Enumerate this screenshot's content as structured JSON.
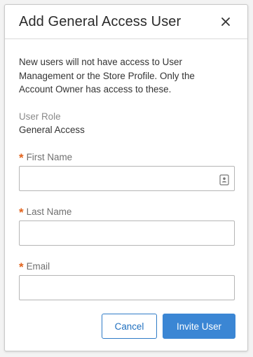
{
  "dialog": {
    "title": "Add General Access User",
    "description": "New users will not have access to User Management or the Store Profile. Only the Account Owner has access to these."
  },
  "user_role": {
    "label": "User Role",
    "value": "General Access"
  },
  "fields": {
    "required_marker": "*",
    "first_name": {
      "label": "First Name",
      "value": "",
      "placeholder": ""
    },
    "last_name": {
      "label": "Last Name",
      "value": "",
      "placeholder": ""
    },
    "email": {
      "label": "Email",
      "value": "",
      "placeholder": ""
    }
  },
  "buttons": {
    "cancel": "Cancel",
    "invite": "Invite User"
  },
  "icons": {
    "close": "close-icon",
    "contact_card": "contact-card-icon"
  },
  "colors": {
    "primary": "#3b86d4",
    "required": "#e2621b",
    "link_text": "#1f6fbf"
  }
}
